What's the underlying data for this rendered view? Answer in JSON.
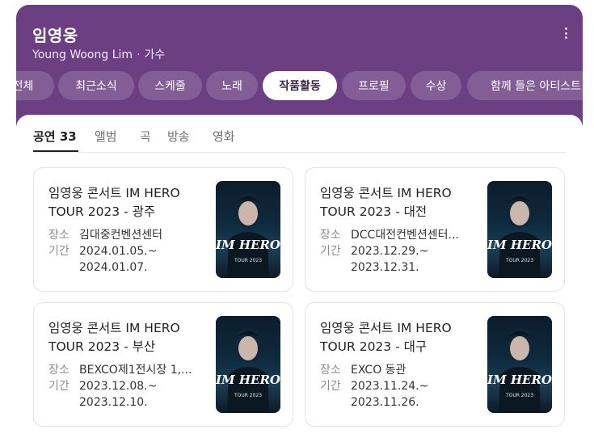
{
  "header": {
    "title": "임영웅",
    "subtitle_en": "Young Woong Lim",
    "subtitle_role": "가수"
  },
  "tabs": [
    {
      "label": "전체"
    },
    {
      "label": "최근소식"
    },
    {
      "label": "스케줄"
    },
    {
      "label": "노래"
    },
    {
      "label": "작품활동",
      "active": true
    },
    {
      "label": "프로필"
    },
    {
      "label": "수상"
    },
    {
      "label": "함께 들은 아티스트"
    }
  ],
  "subtabs": [
    {
      "label": "공연 33",
      "active": true
    },
    {
      "label": "앨범"
    },
    {
      "label": "곡"
    },
    {
      "label": "방송"
    },
    {
      "label": "영화"
    }
  ],
  "cards": [
    {
      "title": "임영웅 콘서트 IM HERO TOUR 2023 - 광주",
      "place_label": "장소",
      "place": "김대중컨벤션센터",
      "period_label": "기간",
      "period_start": "2024.01.05.~",
      "period_end": "2024.01.07.",
      "poster": {
        "text": "IM HERO",
        "subtext": "TOUR 2023"
      }
    },
    {
      "title": "임영웅 콘서트 IM HERO TOUR 2023 - 대전",
      "place_label": "장소",
      "place": "DCC대전컨벤션센터...",
      "period_label": "기간",
      "period_start": "2023.12.29.~",
      "period_end": "2023.12.31.",
      "poster": {
        "text": "IM HERO",
        "subtext": "TOUR 2023"
      }
    },
    {
      "title": "임영웅 콘서트 IM HERO TOUR 2023 - 부산",
      "place_label": "장소",
      "place": "BEXCO제1전시장 1,...",
      "period_label": "기간",
      "period_start": "2023.12.08.~",
      "period_end": "2023.12.10.",
      "poster": {
        "text": "IM HERO",
        "subtext": "TOUR 2023"
      }
    },
    {
      "title": "임영웅 콘서트 IM HERO TOUR 2023 - 대구",
      "place_label": "장소",
      "place": "EXCO 동관",
      "period_label": "기간",
      "period_start": "2023.11.24.~",
      "period_end": "2023.11.26.",
      "poster": {
        "text": "IM HERO",
        "subtext": "TOUR 2023"
      }
    }
  ],
  "colors": {
    "header_bg": "#6b3f82",
    "tab_inactive_bg": "rgba(255,255,255,0.16)",
    "tab_active_bg": "#ffffff",
    "card_border": "#e3e3e3"
  },
  "icons": {
    "more": "more-vertical-icon"
  }
}
